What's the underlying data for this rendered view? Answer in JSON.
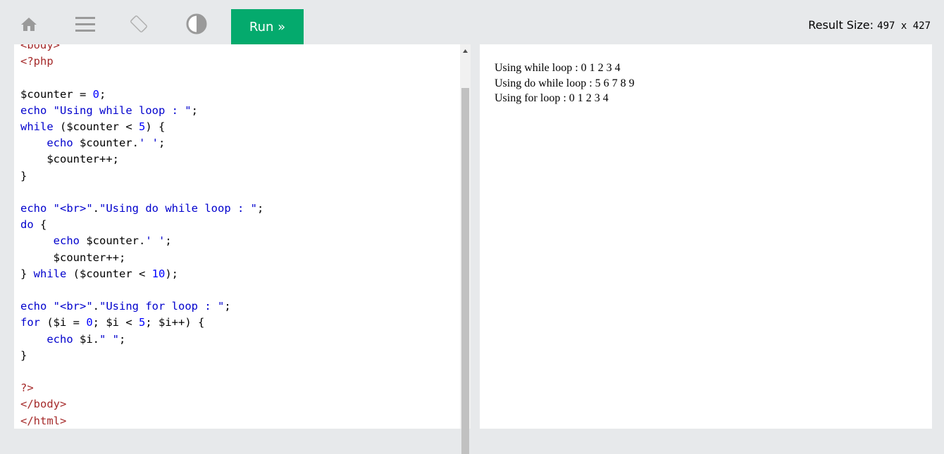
{
  "toolbar": {
    "icons": [
      "home-icon",
      "menu-icon",
      "rotate-icon",
      "contrast-icon"
    ],
    "run_label": "Run »",
    "result_size_label": "Result Size:",
    "result_size_value": "497 x 427"
  },
  "code": {
    "lines": [
      "<body>",
      "<?php",
      "",
      "$counter = 0;",
      "echo \"Using while loop : \";",
      "while ($counter < 5) {",
      "    echo $counter.' ';",
      "    $counter++;",
      "}",
      "",
      "echo \"<br>\".\"Using do while loop : \";",
      "do {",
      "     echo $counter.' ';",
      "     $counter++;",
      "} while ($counter < 10);",
      "",
      "echo \"<br>\".\"Using for loop : \";",
      "for ($i = 0; $i < 5; $i++) {",
      "    echo $i.\" \";",
      "}",
      "",
      "?>",
      "</body>",
      "</html>"
    ]
  },
  "result": {
    "lines": [
      "Using while loop : 0 1 2 3 4",
      "Using do while loop : 5 6 7 8 9",
      "Using for loop : 0 1 2 3 4"
    ]
  },
  "colors": {
    "run_button": "#04aa6d",
    "toolbar_bg": "#e7e9eb",
    "tag": "#a52a2a",
    "keyword": "#0000cd",
    "number": "#0000ff"
  }
}
